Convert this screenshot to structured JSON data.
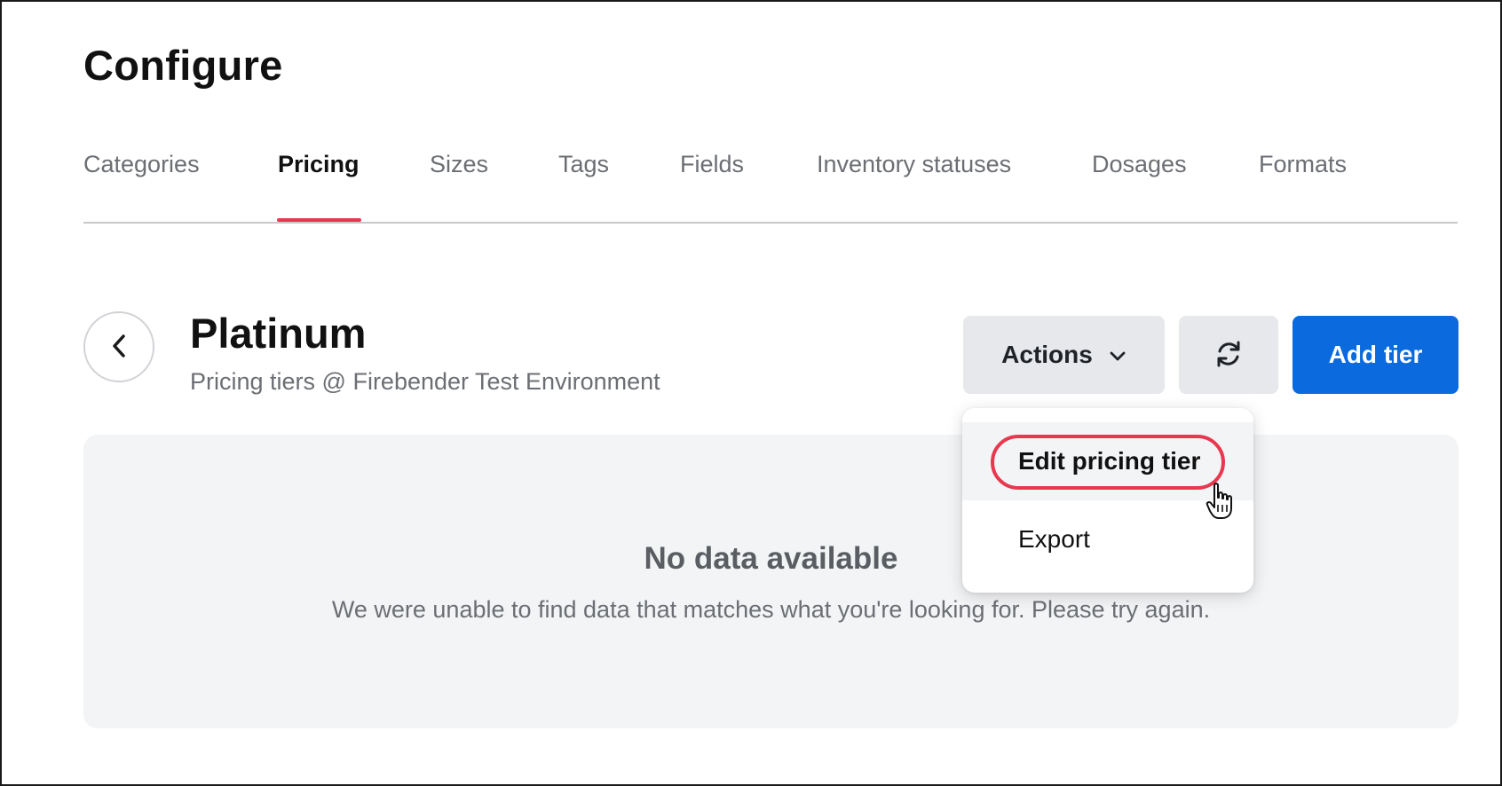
{
  "page": {
    "title": "Configure"
  },
  "tabs": [
    {
      "label": "Categories"
    },
    {
      "label": "Pricing",
      "active": true
    },
    {
      "label": "Sizes"
    },
    {
      "label": "Tags"
    },
    {
      "label": "Fields"
    },
    {
      "label": "Inventory statuses"
    },
    {
      "label": "Dosages"
    },
    {
      "label": "Formats"
    }
  ],
  "header": {
    "title": "Platinum",
    "subtitle": "Pricing tiers @ Firebender Test Environment",
    "back_icon": "chevron-left-icon"
  },
  "toolbar": {
    "actions_label": "Actions",
    "actions_icon": "chevron-down-icon",
    "refresh_icon": "refresh-icon",
    "add_label": "Add tier"
  },
  "actions_menu": {
    "items": [
      {
        "label": "Edit pricing tier",
        "hovered": true
      },
      {
        "label": "Export"
      }
    ]
  },
  "empty_state": {
    "title": "No data available",
    "message": "We were unable to find data that matches what you're looking for. Please try again."
  },
  "colors": {
    "accent": "#e8384f",
    "primary": "#0b6bde",
    "button_gray": "#e6e8eb",
    "panel_bg": "#f3f4f6"
  }
}
